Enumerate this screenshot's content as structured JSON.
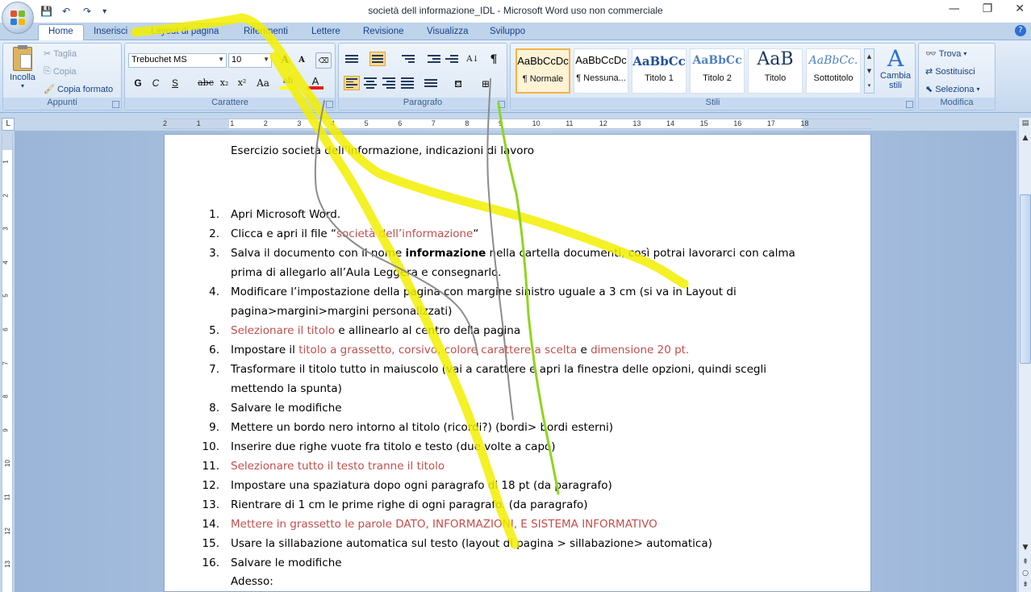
{
  "window": {
    "title": "società dell informazione_IDL - Microsoft Word uso non commerciale",
    "min": "—",
    "max": "❐",
    "close": "✕"
  },
  "qat": {
    "save": "💾",
    "undo": "↶",
    "redo": "↷",
    "more": "▾"
  },
  "tabs": [
    "Home",
    "Inserisci",
    "Layout di pagina",
    "Riferimenti",
    "Lettere",
    "Revisione",
    "Visualizza",
    "Sviluppo"
  ],
  "ribbon": {
    "appunti": {
      "label": "Appunti",
      "paste": "Incolla",
      "cut": "Taglia",
      "copy": "Copia",
      "format_painter": "Copia formato"
    },
    "carattere": {
      "label": "Carattere",
      "font": "Trebuchet MS",
      "size": "10",
      "grow": "A",
      "shrink": "A",
      "bold": "G",
      "italic": "C",
      "underline": "S",
      "strike": "abc",
      "subscript": "x₂",
      "superscript": "x²",
      "case": "Aa",
      "highlight": "ab",
      "font_color": "A"
    },
    "paragrafo": {
      "label": "Paragrafo",
      "pilcrow": "¶",
      "sort": "A↓"
    },
    "stili": {
      "label": "Stili",
      "tiles": [
        {
          "preview": "AaBbCcDc",
          "name": "¶ Normale"
        },
        {
          "preview": "AaBbCcDc",
          "name": "¶ Nessuna..."
        },
        {
          "preview": "AaBbCc",
          "name": "Titolo 1"
        },
        {
          "preview": "AaBbCc",
          "name": "Titolo 2"
        },
        {
          "preview": "AaB",
          "name": "Titolo"
        },
        {
          "preview": "AaBbCc.",
          "name": "Sottotitolo"
        }
      ],
      "change_styles": "Cambia stili"
    },
    "modifica": {
      "label": "Modifica",
      "find": "Trova",
      "replace": "Sostituisci",
      "select": "Seleziona"
    }
  },
  "ruler": {
    "corner": "L",
    "h_numbers": [
      "2",
      "1",
      "1",
      "2",
      "3",
      "4",
      "5",
      "6",
      "7",
      "8",
      "9",
      "10",
      "11",
      "12",
      "13",
      "14",
      "15",
      "16",
      "17",
      "18"
    ],
    "v_numbers": [
      "1",
      "2",
      "3",
      "4",
      "5",
      "6",
      "7",
      "8",
      "9",
      "10",
      "11",
      "12",
      "13"
    ]
  },
  "document": {
    "heading": "Esercizio società dell’informazione, indicazioni di lavoro",
    "items": [
      {
        "n": "1.",
        "parts": [
          {
            "t": "Apri Microsoft Word."
          }
        ]
      },
      {
        "n": "2.",
        "parts": [
          {
            "t": "Clicca e  apri il file  “"
          },
          {
            "t": "società dell’informazione",
            "c": "red"
          },
          {
            "t": "“"
          }
        ]
      },
      {
        "n": "3.",
        "parts": [
          {
            "t": "Salva il documento con il nome "
          },
          {
            "t": "informazione",
            "c": "bold"
          },
          {
            "t": " nella cartella documenti, così potrai lavorarci con calma"
          }
        ],
        "cont": "prima di allegarlo all’Aula Leggera e consegnarlo."
      },
      {
        "n": "4.",
        "parts": [
          {
            "t": "Modificare l’impostazione della pagina con margine sinistro uguale a 3 cm (si va in Layout di"
          }
        ],
        "cont": "pagina>margini>margini personalizzati)"
      },
      {
        "n": "5.",
        "parts": [
          {
            "t": "Selezionare il titolo",
            "c": "red"
          },
          {
            "t": " e allinearlo al centro della pagina"
          }
        ]
      },
      {
        "n": "6.",
        "parts": [
          {
            "t": "Impostare il "
          },
          {
            "t": "titolo a grassetto, corsivo",
            "c": "red"
          },
          {
            "t": ", "
          },
          {
            "t": "colore carattere a scelta",
            "c": "red"
          },
          {
            "t": " e "
          },
          {
            "t": "dimensione 20 pt.",
            "c": "red"
          }
        ]
      },
      {
        "n": "7.",
        "parts": [
          {
            "t": "Trasformare il titolo tutto in maiuscolo (vai a carattere e apri la finestra delle opzioni, quindi scegli"
          }
        ],
        "cont": "mettendo la spunta)"
      },
      {
        "n": "8.",
        "parts": [
          {
            "t": "Salvare le modifiche"
          }
        ]
      },
      {
        "n": "9.",
        "parts": [
          {
            "t": "Mettere un bordo nero intorno al titolo (ricordi?) (bordi> bordi esterni)"
          }
        ]
      },
      {
        "n": "10.",
        "parts": [
          {
            "t": "Inserire due righe vuote fra titolo e testo (due volte a capo)"
          }
        ]
      },
      {
        "n": "11.",
        "parts": [
          {
            "t": "Selezionare tutto il testo tranne il titolo",
            "c": "red"
          }
        ]
      },
      {
        "n": "12.",
        "parts": [
          {
            "t": "Impostare una spaziatura dopo ogni paragrafo di 18 pt    (da paragrafo)"
          }
        ]
      },
      {
        "n": "13.",
        "parts": [
          {
            "t": "Rientrare di 1 cm le prime righe di ogni paragrafo.   (da paragrafo)"
          }
        ]
      },
      {
        "n": "14.",
        "parts": [
          {
            "t": "Mettere in grassetto le parole DATO, INFORMAZIONI, E SISTEMA INFORMATIVO",
            "c": "red"
          }
        ]
      },
      {
        "n": "15.",
        "parts": [
          {
            "t": "Usare la sillabazione automatica sul testo (layout di pagina > sillabazione> automatica)"
          }
        ]
      },
      {
        "n": "16.",
        "parts": [
          {
            "t": "Salvare le modifiche"
          }
        ]
      }
    ],
    "footer": "Adesso:"
  },
  "colors": {
    "annotation_yellow": "#f2ee00",
    "annotation_green": "#8fd41f",
    "annotation_gray": "#8c8c8c",
    "red_text": "#c0504d"
  }
}
